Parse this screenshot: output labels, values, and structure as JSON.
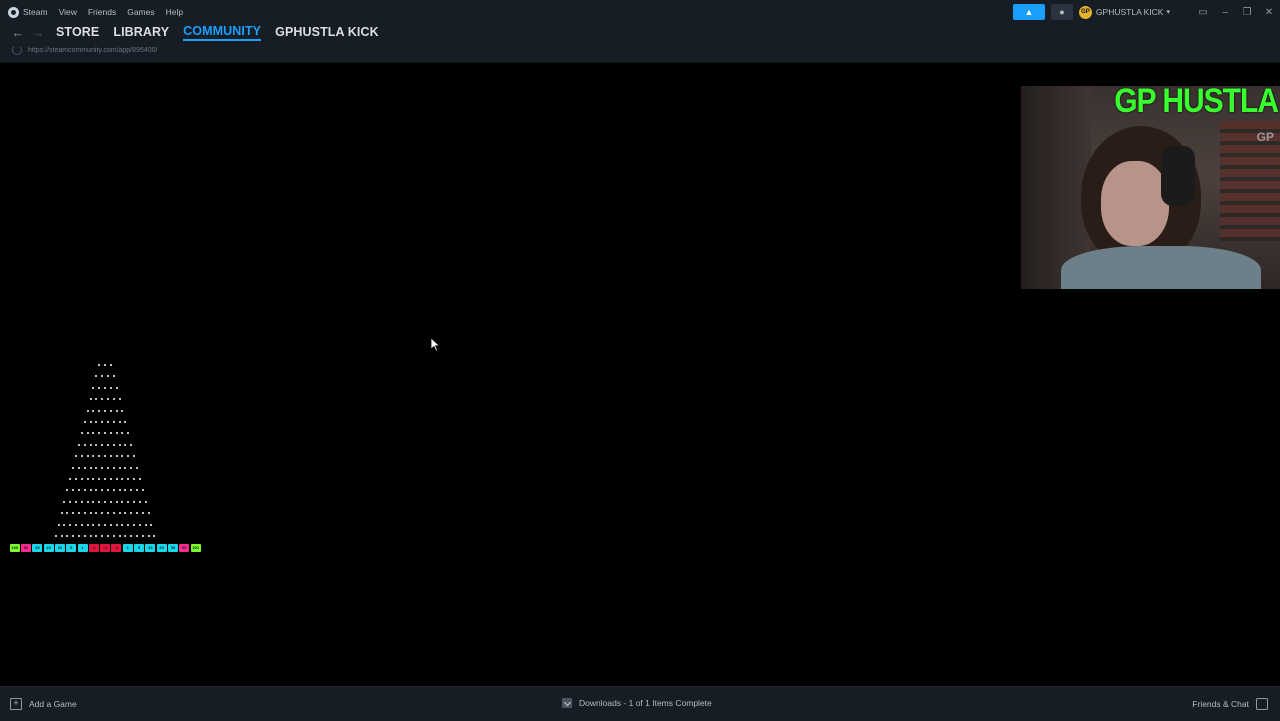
{
  "menu": {
    "app_name": "Steam",
    "items": [
      "View",
      "Friends",
      "Games",
      "Help"
    ]
  },
  "nav": {
    "back_icon": "back-arrow-icon",
    "forward_icon": "forward-arrow-icon",
    "tabs": [
      {
        "label": "STORE",
        "active": false
      },
      {
        "label": "LIBRARY",
        "active": false
      },
      {
        "label": "COMMUNITY",
        "active": true
      },
      {
        "label": "GPHUSTLA KICK",
        "active": false
      }
    ],
    "url": "https://steamcommunity.com/app/895400/"
  },
  "account": {
    "name": "GPHUSTLA KICK",
    "avatar_text": "GP"
  },
  "webcam": {
    "overlay_title": "GP HUSTLA",
    "watermark": "GP"
  },
  "plinko": {
    "buckets": [
      {
        "label": "100",
        "color": "#7cfc2c"
      },
      {
        "label": "50",
        "color": "#ff2b8a"
      },
      {
        "label": "35",
        "color": "#19d7e8"
      },
      {
        "label": "20",
        "color": "#19d7e8"
      },
      {
        "label": "10",
        "color": "#19d7e8"
      },
      {
        "label": "5",
        "color": "#19d7e8"
      },
      {
        "label": "1",
        "color": "#19d7e8"
      },
      {
        "label": "-1",
        "color": "#e0143c"
      },
      {
        "label": "-2",
        "color": "#e0143c"
      },
      {
        "label": "-1",
        "color": "#e0143c"
      },
      {
        "label": "1",
        "color": "#19d7e8"
      },
      {
        "label": "5",
        "color": "#19d7e8"
      },
      {
        "label": "10",
        "color": "#19d7e8"
      },
      {
        "label": "20",
        "color": "#19d7e8"
      },
      {
        "label": "35",
        "color": "#19d7e8"
      },
      {
        "label": "50",
        "color": "#ff2b8a"
      },
      {
        "label": "100",
        "color": "#7cfc2c"
      }
    ]
  },
  "footer": {
    "add_game": "Add a Game",
    "downloads": "Downloads - 1 of 1 Items Complete",
    "friends_chat": "Friends & Chat"
  }
}
